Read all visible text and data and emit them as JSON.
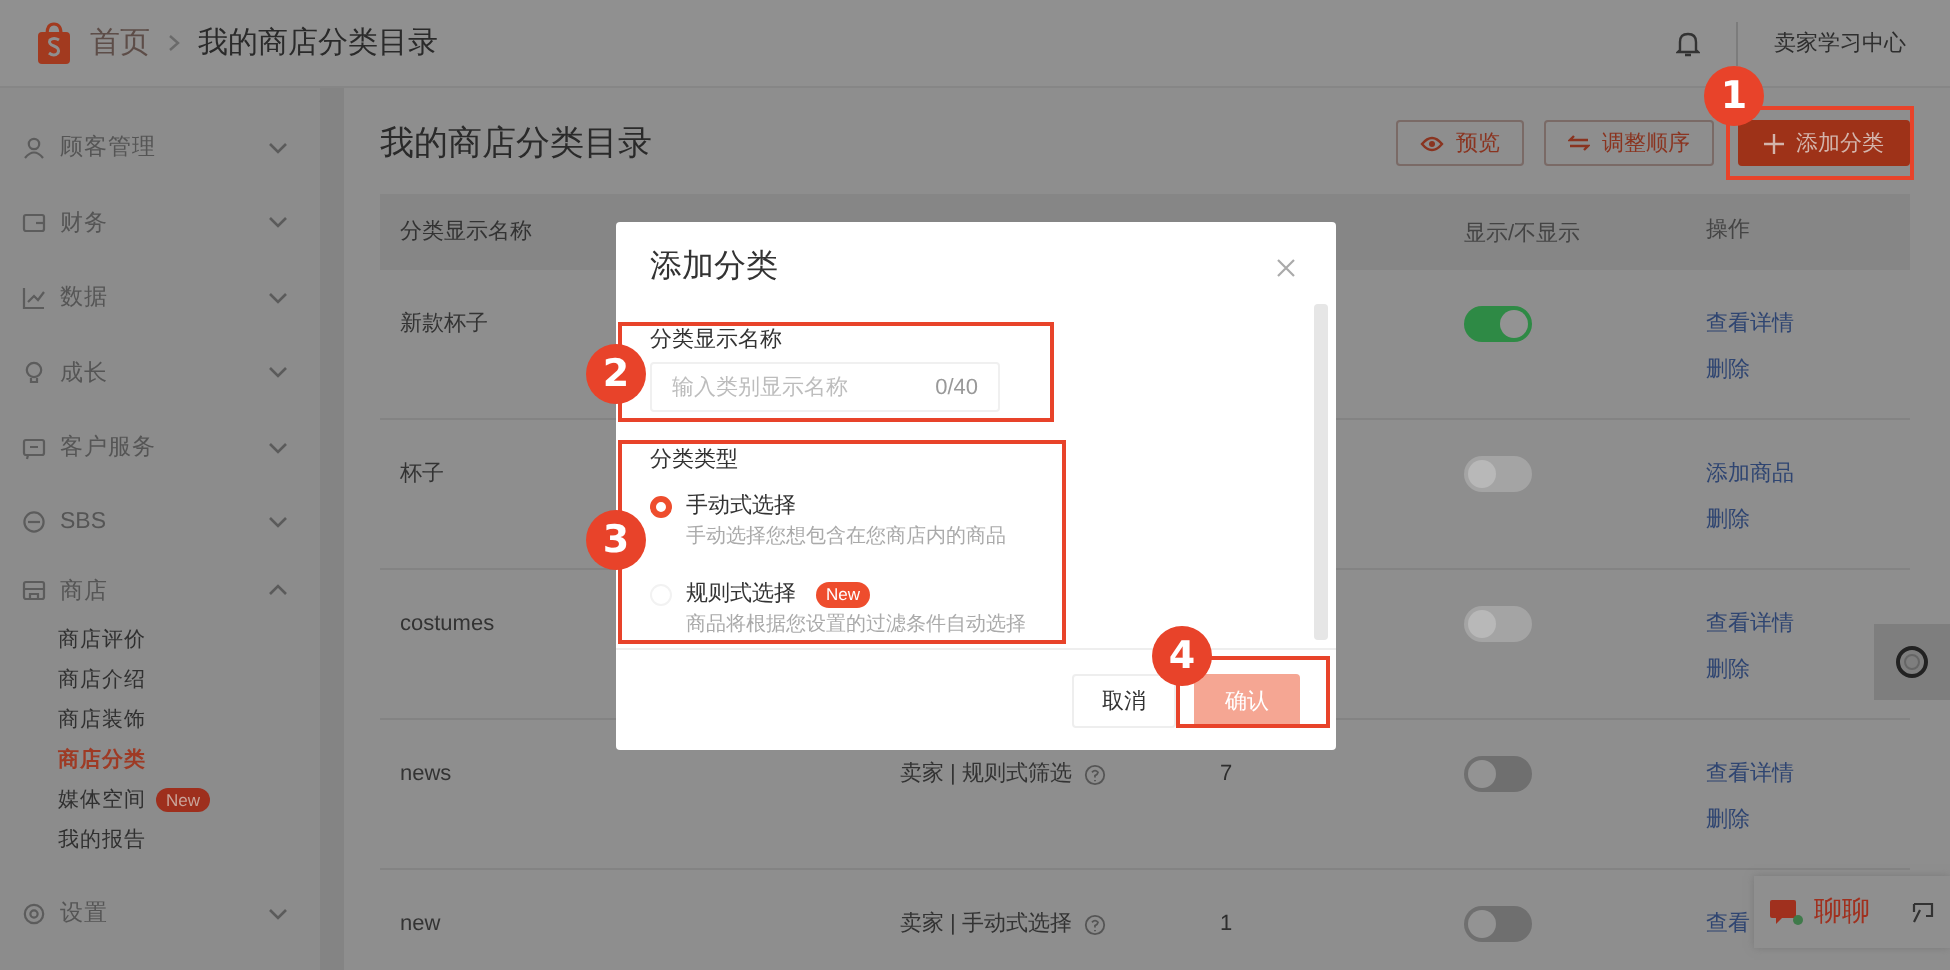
{
  "header": {
    "breadcrumb": [
      {
        "label": "首页",
        "kind": "link"
      },
      {
        "label": "我的商店分类目录",
        "kind": "current"
      }
    ],
    "learning_center": "卖家学习中心"
  },
  "sidebar": {
    "items": [
      {
        "label": "顾客管理",
        "expanded": false
      },
      {
        "label": "财务",
        "expanded": false
      },
      {
        "label": "数据",
        "expanded": false
      },
      {
        "label": "成长",
        "expanded": false
      },
      {
        "label": "客户服务",
        "expanded": false
      },
      {
        "label": "SBS",
        "expanded": false
      },
      {
        "label": "商店",
        "expanded": true,
        "children": [
          {
            "label": "商店评价",
            "selected": false
          },
          {
            "label": "商店介绍",
            "selected": false
          },
          {
            "label": "商店装饰",
            "selected": false
          },
          {
            "label": "商店分类",
            "selected": true
          },
          {
            "label": "媒体空间",
            "selected": false,
            "badge": "New"
          },
          {
            "label": "我的报告",
            "selected": false
          }
        ]
      },
      {
        "label": "设置",
        "expanded": false
      }
    ]
  },
  "page": {
    "title": "我的商店分类目录",
    "buttons": [
      {
        "label": "预览",
        "kind": "preview"
      },
      {
        "label": "调整顺序",
        "kind": "reorder"
      },
      {
        "label": "添加分类",
        "kind": "add"
      }
    ]
  },
  "table": {
    "columns": [
      {
        "label": "分类显示名称"
      },
      {
        "label": "显示/不显示"
      },
      {
        "label": "操作"
      }
    ],
    "rows": [
      {
        "name": "新款杯子",
        "shown": true,
        "disabled": false,
        "actions": [
          "查看详情",
          "删除"
        ]
      },
      {
        "name": "杯子",
        "shown": false,
        "disabled": true,
        "actions": [
          "添加商品",
          "删除"
        ]
      },
      {
        "name": "costumes",
        "shown": false,
        "disabled": true,
        "actions": [
          "查看详情",
          "删除"
        ]
      },
      {
        "name": "news",
        "column_3": "卖家 | 规则式筛选",
        "column_4": "7",
        "shown": false,
        "disabled": false,
        "actions": [
          "查看详情",
          "删除"
        ]
      },
      {
        "name": "new",
        "column_3": "卖家 | 手动式选择",
        "column_4": "1",
        "shown": false,
        "disabled": false,
        "actions": [
          "查看"
        ]
      }
    ]
  },
  "modal": {
    "title": "添加分类",
    "name_field": {
      "label": "分类显示名称",
      "placeholder": "输入类别显示名称",
      "counter": "0/40"
    },
    "type_label": "分类类型",
    "options": [
      {
        "label": "手动式选择",
        "description": "手动选择您想包含在您商店内的商品",
        "selected": true
      },
      {
        "label": "规则式选择",
        "badge": "New",
        "description": "商品将根据您设置的过滤条件自动选择",
        "selected": false
      }
    ],
    "buttons": [
      {
        "label": "取消",
        "kind": "secondary",
        "disabled": false
      },
      {
        "label": "确认",
        "kind": "primary",
        "disabled": true
      }
    ]
  },
  "callouts": [
    {
      "number": "1"
    },
    {
      "number": "2"
    },
    {
      "number": "3"
    },
    {
      "number": "4"
    }
  ],
  "chat": {
    "label": "聊聊"
  }
}
